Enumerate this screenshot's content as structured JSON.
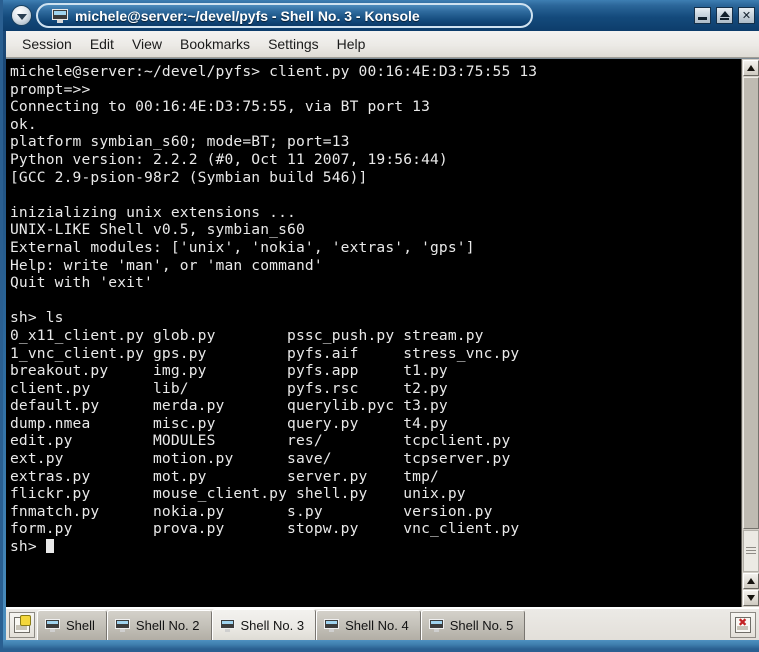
{
  "window": {
    "title": "michele@server:~/devel/pyfs - Shell No. 3 - Konsole",
    "menu_button_icon": "chevron-down-icon",
    "title_icon": "terminal-monitor-icon",
    "buttons": [
      {
        "name": "minimize-button",
        "label": "_"
      },
      {
        "name": "shade-button",
        "label": "▲"
      },
      {
        "name": "close-button",
        "label": "×"
      }
    ]
  },
  "menubar": {
    "items": [
      {
        "label": "Session"
      },
      {
        "label": "Edit"
      },
      {
        "label": "View"
      },
      {
        "label": "Bookmarks"
      },
      {
        "label": "Settings"
      },
      {
        "label": "Help"
      }
    ]
  },
  "terminal": {
    "foreground": "#e9e9e9",
    "background": "#000000",
    "lines": [
      "michele@server:~/devel/pyfs> client.py 00:16:4E:D3:75:55 13",
      "prompt=>>",
      "Connecting to 00:16:4E:D3:75:55, via BT port 13",
      "ok.",
      "platform symbian_s60; mode=BT; port=13",
      "Python version: 2.2.2 (#0, Oct 11 2007, 19:56:44)",
      "[GCC 2.9-psion-98r2 (Symbian build 546)]",
      "",
      "inizializing unix extensions ...",
      "UNIX-LIKE Shell v0.5, symbian_s60",
      "External modules: ['unix', 'nokia', 'extras', 'gps']",
      "Help: write 'man', or 'man command'",
      "Quit with 'exit'",
      "",
      "sh> ls",
      "0_x11_client.py glob.py        pssc_push.py stream.py",
      "1_vnc_client.py gps.py         pyfs.aif     stress_vnc.py",
      "breakout.py     img.py         pyfs.app     t1.py",
      "client.py       lib/           pyfs.rsc     t2.py",
      "default.py      merda.py       querylib.pyc t3.py",
      "dump.nmea       misc.py        query.py     t4.py",
      "edit.py         MODULES        res/         tcpclient.py",
      "ext.py          motion.py      save/        tcpserver.py",
      "extras.py       mot.py         server.py    tmp/",
      "flickr.py       mouse_client.py shell.py    unix.py",
      "fnmatch.py      nokia.py       s.py         version.py",
      "form.py         prova.py       stopw.py     vnc_client.py"
    ],
    "prompt": "sh> ",
    "cursor": "block"
  },
  "scrollbar": {
    "top_button_icon": "arrow-up-icon",
    "bottom_up_button_icon": "arrow-up-icon",
    "bottom_down_button_icon": "arrow-down-icon"
  },
  "taskbar": {
    "new_session_icon": "new-session-icon",
    "close_session_icon": "close-session-icon",
    "tabs": [
      {
        "label": "Shell",
        "active": false
      },
      {
        "label": "Shell No. 2",
        "active": false
      },
      {
        "label": "Shell No. 3",
        "active": true
      },
      {
        "label": "Shell No. 4",
        "active": false
      },
      {
        "label": "Shell No. 5",
        "active": false
      }
    ]
  }
}
